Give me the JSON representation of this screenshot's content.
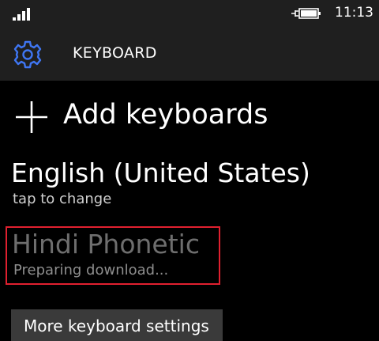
{
  "status_bar": {
    "time": "11:13",
    "icons": [
      "signal-icon",
      "battery-charging-icon"
    ]
  },
  "header": {
    "icon": "gear-icon",
    "title": "KEYBOARD"
  },
  "add_keyboards": {
    "icon": "plus-icon",
    "label": "Add keyboards"
  },
  "keyboards": [
    {
      "name": "English (United States)",
      "subtitle": "tap to change"
    },
    {
      "name": "Hindi Phonetic",
      "subtitle": "Preparing download..."
    }
  ],
  "more_button": {
    "label": "More keyboard settings"
  },
  "colors": {
    "accent": "#3f76f3",
    "highlight_border": "#e0202f",
    "background": "#000000",
    "header_background": "#1f1f1f"
  }
}
